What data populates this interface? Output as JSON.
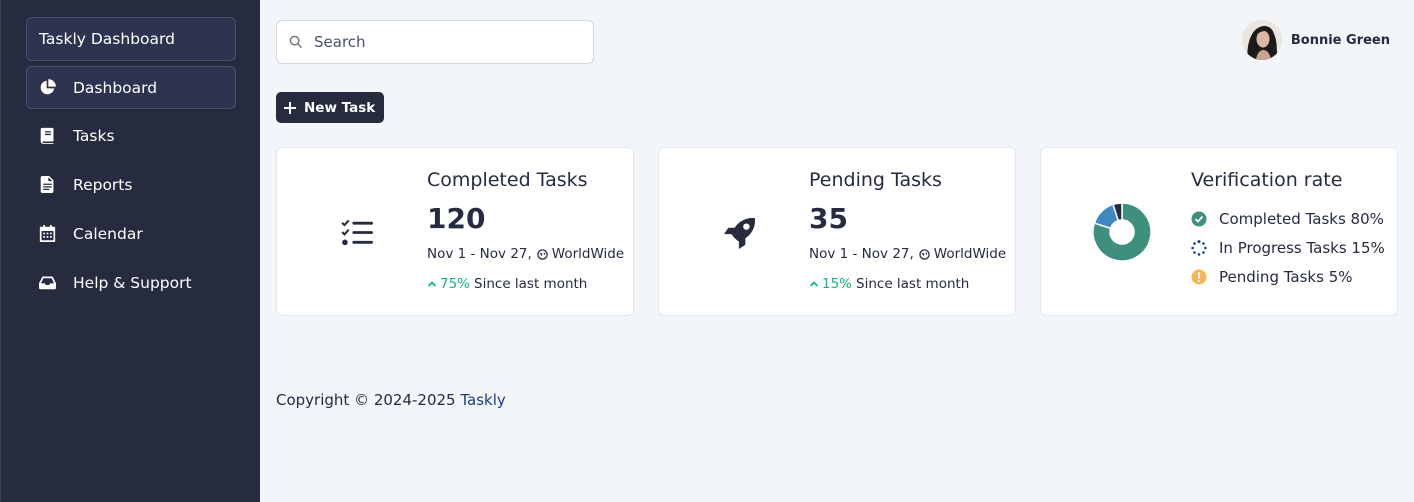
{
  "sidebar": {
    "brand": "Taskly Dashboard",
    "items": [
      {
        "label": "Dashboard",
        "icon": "chart-pie-icon",
        "active": true
      },
      {
        "label": "Tasks",
        "icon": "book-icon"
      },
      {
        "label": "Reports",
        "icon": "file-icon"
      },
      {
        "label": "Calendar",
        "icon": "calendar-icon"
      },
      {
        "label": "Help & Support",
        "icon": "inbox-icon"
      }
    ]
  },
  "header": {
    "search_placeholder": "Search",
    "user_name": "Bonnie Green"
  },
  "toolbar": {
    "new_task_label": "New Task"
  },
  "cards": {
    "completed": {
      "title": "Completed Tasks",
      "value": "120",
      "range": "Nov 1 - Nov 27,",
      "region": "WorldWide",
      "trend": "75%",
      "trend_text": "Since last month",
      "icon": "tasks-icon"
    },
    "pending": {
      "title": "Pending Tasks",
      "value": "35",
      "range": "Nov 1 - Nov 27,",
      "region": "WorldWide",
      "trend": "15%",
      "trend_text": "Since last month",
      "icon": "rocket-icon"
    },
    "verification": {
      "title": "Verification rate",
      "legend": [
        {
          "label": "Completed Tasks 80%",
          "icon": "check-circle-icon",
          "value": 80,
          "color": "#3f8f7f"
        },
        {
          "label": "In Progress Tasks 15%",
          "icon": "spinner-icon",
          "value": 15,
          "color": "#3e88c4"
        },
        {
          "label": "Pending Tasks 5%",
          "icon": "exclamation-circle-icon",
          "value": 5,
          "color": "#262b40"
        }
      ]
    }
  },
  "colors": {
    "sidebar_bg": "#262b40",
    "page_bg": "#f3f6f9",
    "success": "#10b981",
    "completed": "#3f8f7f",
    "in_progress": "#3e88c4",
    "warning": "#f5b759",
    "link": "#1e3a8a"
  },
  "footer": {
    "copyright": "Copyright © 2024-2025",
    "brand_link": "Taskly"
  }
}
